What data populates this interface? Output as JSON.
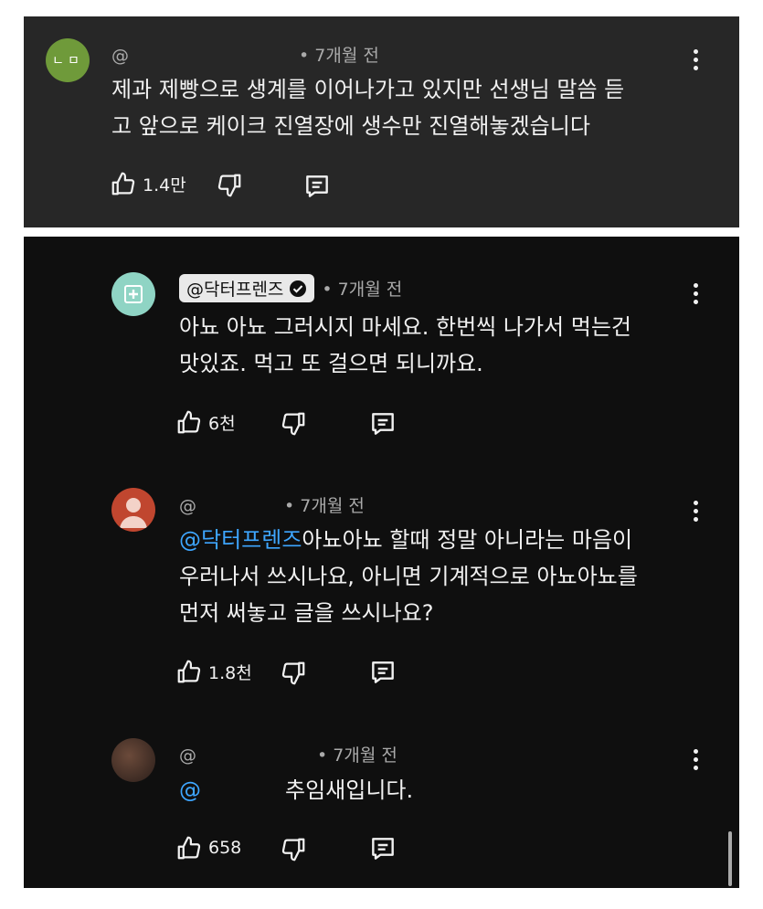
{
  "comments": [
    {
      "handle": "@",
      "avatar_text": "ㄴㅁ",
      "avatar_color": "#6f9a3a",
      "time": "• 7개월 전",
      "lines": [
        "제과 제빵으로 생계를 이어나가고 있지만 선생님 말씀 듣",
        "고 앞으로 케이크 진열장에 생수만 진열해놓겠습니다"
      ],
      "likes": "1.4만"
    },
    {
      "handle": "@닥터프렌즈",
      "verified": true,
      "avatar_color": "#8fd4c4",
      "time": "• 7개월 전",
      "lines": [
        "아뇨 아뇨 그러시지 마세요. 한번씩 나가서 먹는건",
        "맛있죠. 먹고 또 걸으면 되니까요."
      ],
      "likes": "6천"
    },
    {
      "handle": "@",
      "avatar_color": "#c0462f",
      "time": "• 7개월 전",
      "mention": "@닥터프렌즈",
      "lines": [
        "아뇨아뇨 할때 정말 아니라는 마음이",
        "우러나서 쓰시나요, 아니면 기계적으로 아뇨아뇨를",
        "먼저 써놓고 글을 쓰시나요?"
      ],
      "likes": "1.8천"
    },
    {
      "handle": "@",
      "avatar_color": "#3a2a24",
      "time": "• 7개월 전",
      "mention": "@",
      "lines": [
        "추임새입니다."
      ],
      "likes": "658"
    }
  ],
  "colors": {
    "panel_top": "#272727",
    "panel_main": "#0f0f0f",
    "mention": "#3ea6ff",
    "text": "#f1f1f1",
    "meta": "#aaaaaa"
  },
  "icons": [
    "thumbs-up-icon",
    "thumbs-down-icon",
    "reply-icon",
    "more-vert-icon",
    "verified-check-icon"
  ]
}
